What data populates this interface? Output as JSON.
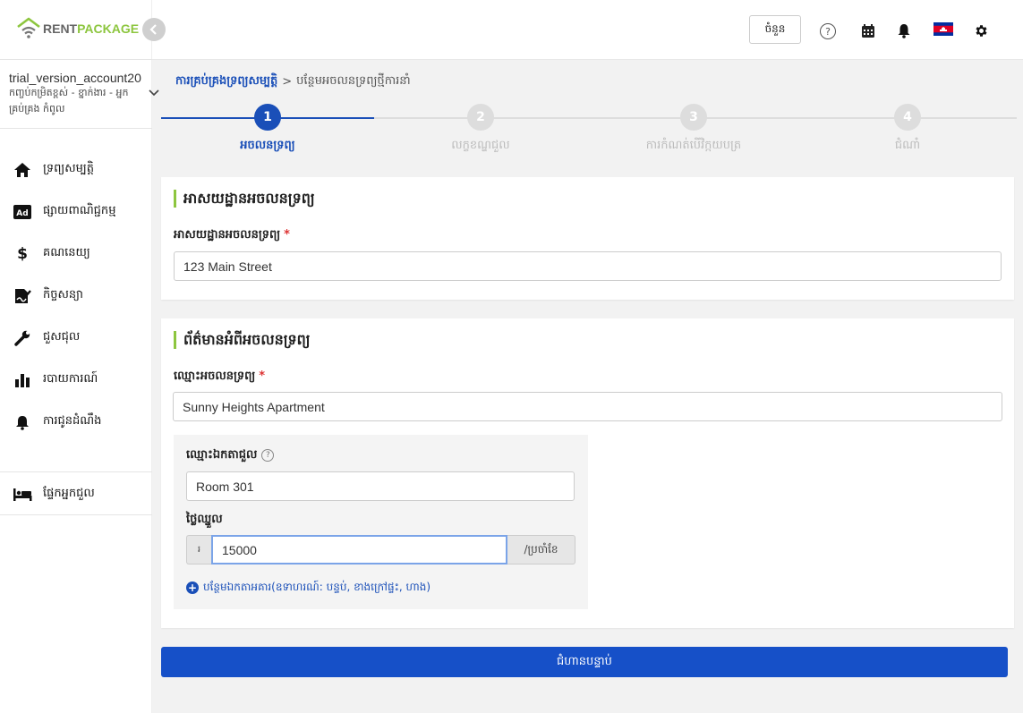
{
  "brand": {
    "part1": "RENT",
    "part2": "PACKAGE",
    "color_gray": "#666666",
    "color_green": "#8dc63f"
  },
  "account": {
    "name": "trial_version_account20",
    "role": "កញ្ចប់កម្រិតខ្ពស់ - ខ្នាក់ងារ - អ្នកគ្រប់គ្រង កំពូល"
  },
  "sidebar": {
    "items": [
      {
        "label": "ទ្រព្យសម្បត្តិ",
        "icon": "home-icon"
      },
      {
        "label": "ផ្សាយពាណិជ្ជកម្ម",
        "icon": "ad-icon"
      },
      {
        "label": "គណនេយ្យ",
        "icon": "dollar-icon"
      },
      {
        "label": "កិច្ចសន្យា",
        "icon": "contract-icon"
      },
      {
        "label": "ជួសជុល",
        "icon": "wrench-icon"
      },
      {
        "label": "របាយការណ៍",
        "icon": "chart-icon"
      },
      {
        "label": "ការជូនដំណឹង",
        "icon": "bell-icon"
      }
    ],
    "tenant": {
      "label": "ផ្ទែកអ្នកជួល",
      "icon": "bed-icon"
    }
  },
  "header": {
    "button_label": "ចំនួន",
    "help": "?",
    "icons": [
      "help-icon",
      "calendar-icon",
      "notification-bell-icon",
      "cambodia-flag-icon",
      "settings-gear-icon"
    ]
  },
  "breadcrumb": {
    "link": "ការគ្រប់គ្រងទ្រព្យសម្បត្តិ",
    "separator": ">",
    "current": "បន្ថែមអចលនទ្រព្យថ្មីការនាំ"
  },
  "stepper": {
    "steps": [
      {
        "number": "1",
        "label": "អចលនទ្រព្យ",
        "active": true
      },
      {
        "number": "2",
        "label": "លក្ខខណ្ឌជួល",
        "active": false
      },
      {
        "number": "3",
        "label": "ការកំណត់បើវិក្កយបត្រ",
        "active": false
      },
      {
        "number": "4",
        "label": "ជំណាំ",
        "active": false
      }
    ],
    "accent": "#1a4fb8"
  },
  "address_section": {
    "title": "អាសយដ្ឋានអចលនទ្រព្យ",
    "field_label": "អាសយដ្ឋានអចលនទ្រព្យ",
    "required": "*",
    "value": "123 Main Street"
  },
  "info_section": {
    "title": "ព័ត៌មានអំពីអចលនទ្រព្យ",
    "name_label": "ឈ្មោះអចលនទ្រព្យ",
    "required": "*",
    "name_value": "Sunny Heights Apartment",
    "unit": {
      "unit_label": "ឈ្មោះឯកតាជួល",
      "help": "?",
      "unit_value": "Room 301",
      "rent_label": "ថ្លៃឈ្នួល",
      "currency": "៛",
      "rent_value": "15000",
      "rent_suffix": "/ប្រចាំខែ"
    },
    "add_unit_label": "បន្ថែមឯកតាអគារ(ឧទាហរណ៍: បន្ទប់, ខាងក្រៅផ្ទះ, ហាង)"
  },
  "next_button": {
    "label": "ជំហានបន្ទាប់",
    "color": "#1650c8"
  }
}
